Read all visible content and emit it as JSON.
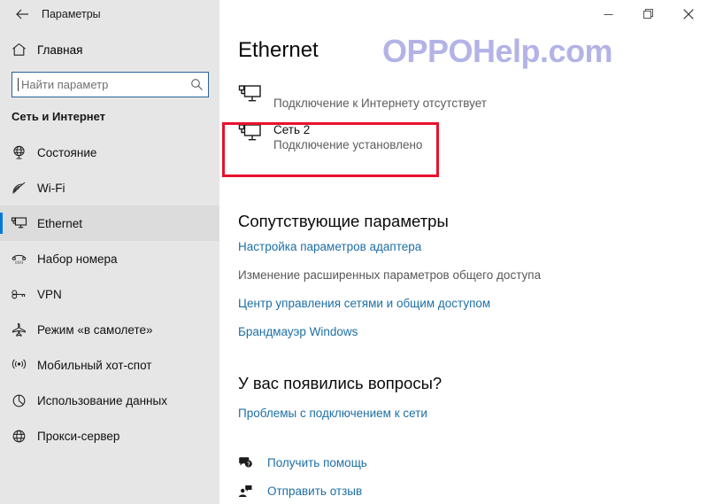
{
  "window": {
    "title": "Параметры",
    "back_icon": "back-arrow-icon",
    "minimize_label": "",
    "maximize_label": "",
    "close_label": ""
  },
  "sidebar": {
    "home_label": "Главная",
    "home_icon": "home-icon",
    "search": {
      "placeholder": "Найти параметр",
      "value": "",
      "icon": "search-icon"
    },
    "section_title": "Сеть и Интернет",
    "items": [
      {
        "label": "Состояние",
        "icon": "globe-status-icon",
        "selected": false
      },
      {
        "label": "Wi-Fi",
        "icon": "wifi-icon",
        "selected": false
      },
      {
        "label": "Ethernet",
        "icon": "ethernet-monitor-icon",
        "selected": true
      },
      {
        "label": "Набор номера",
        "icon": "dialup-phone-icon",
        "selected": false
      },
      {
        "label": "VPN",
        "icon": "vpn-key-icon",
        "selected": false
      },
      {
        "label": "Режим «в самолете»",
        "icon": "airplane-icon",
        "selected": false
      },
      {
        "label": "Мобильный хот-спот",
        "icon": "hotspot-antenna-icon",
        "selected": false
      },
      {
        "label": "Использование данных",
        "icon": "data-usage-pie-icon",
        "selected": false
      },
      {
        "label": "Прокси-сервер",
        "icon": "proxy-globe-icon",
        "selected": false
      }
    ]
  },
  "main": {
    "page_title": "Ethernet",
    "watermark": "OPPOHelp.com",
    "networks": [
      {
        "name": "",
        "status": "Подключение к Интернету отсутствует",
        "icon": "ethernet-monitor-icon",
        "highlighted": false
      },
      {
        "name": "Сеть 2",
        "status": "Подключение установлено",
        "icon": "ethernet-monitor-icon",
        "highlighted": true
      }
    ],
    "highlight_color": "#e8112d",
    "related": {
      "heading": "Сопутствующие параметры",
      "links": [
        {
          "label": "Настройка параметров адаптера",
          "is_link": true
        },
        {
          "label": "Изменение расширенных параметров общего доступа",
          "is_link": false
        },
        {
          "label": "Центр управления сетями и общим доступом",
          "is_link": true
        },
        {
          "label": "Брандмауэр Windows",
          "is_link": true
        }
      ]
    },
    "questions": {
      "heading": "У вас появились вопросы?",
      "link": "Проблемы с подключением к сети"
    },
    "help": [
      {
        "label": "Получить помощь",
        "icon": "question-bubble-icon"
      },
      {
        "label": "Отправить отзыв",
        "icon": "feedback-person-icon"
      }
    ]
  }
}
